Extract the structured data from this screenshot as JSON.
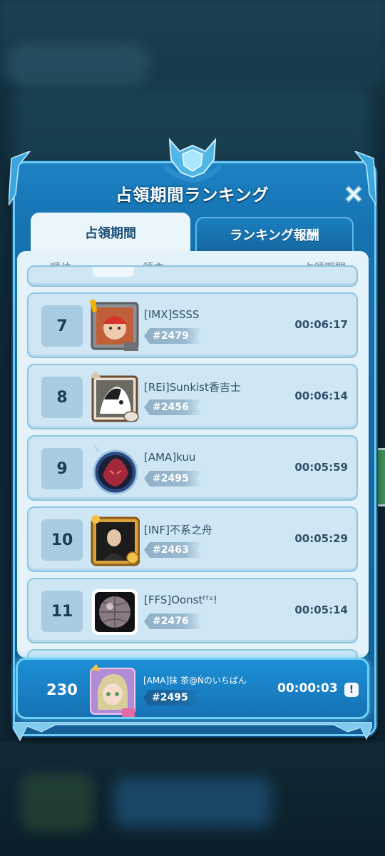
{
  "popup": {
    "title": "占領期間ランキング",
    "close_icon": "close-icon",
    "tabs": [
      {
        "label": "占領期間",
        "active": true
      },
      {
        "label": "ランキング報酬",
        "active": false
      }
    ],
    "columns": {
      "rank": "順位",
      "lord": "領主",
      "duration": "占領期間"
    }
  },
  "rows": [
    {
      "rank": "7",
      "name": "[IMX]SSSS",
      "tag": "#2479",
      "time": "00:06:17",
      "avatar": "baby-red-hat-avatar"
    },
    {
      "rank": "8",
      "name": "[REi]Sunkist香吉士",
      "tag": "#2456",
      "time": "00:06:14",
      "avatar": "dog-avatar"
    },
    {
      "rank": "9",
      "name": "[AMA]kuu",
      "tag": "#2495",
      "time": "00:05:59",
      "avatar": "anime-warrior-avatar"
    },
    {
      "rank": "10",
      "name": "[INF]不系之舟",
      "tag": "#2463",
      "time": "00:05:29",
      "avatar": "man-portrait-avatar"
    },
    {
      "rank": "11",
      "name": "[FFS]Oonstᶠᶠˢ!",
      "tag": "#2476",
      "time": "00:05:14",
      "avatar": "disco-ball-avatar"
    }
  ],
  "self": {
    "rank": "230",
    "name": "[AMA]抹 茶@Ṅのいちばん",
    "tag": "#2495",
    "time": "00:00:03",
    "info_label": "!",
    "avatar": "anime-girl-avatar"
  },
  "colors": {
    "panel": "#1672b0",
    "list_bg": "#e4f2fa",
    "row_bg": "#cfe7f4",
    "accent": "#6fd0f5"
  }
}
